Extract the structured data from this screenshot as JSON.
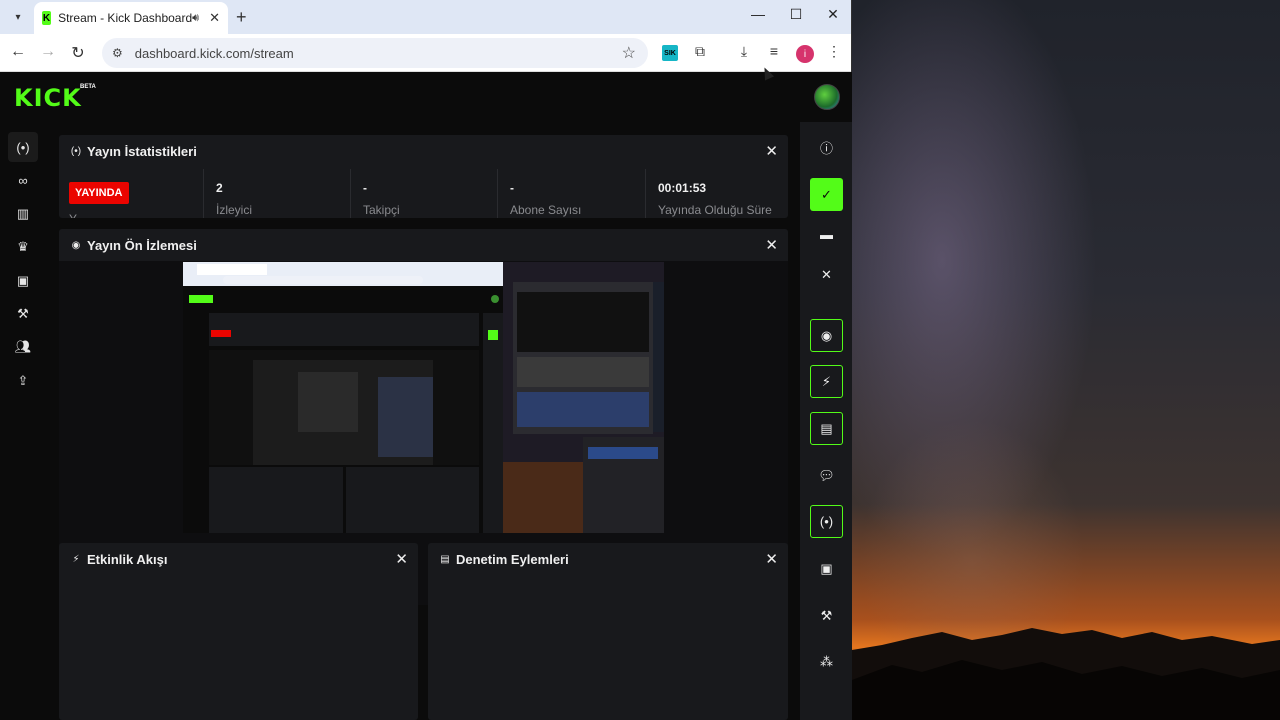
{
  "browser": {
    "tab_title": "Stream - Kick Dashboard",
    "favicon_letter": "K",
    "url": "dashboard.kick.com/stream",
    "extension_label": "SIK",
    "profile_initial": "i"
  },
  "app": {
    "logo": "KICK",
    "logo_badge": "BETA"
  },
  "stats_panel": {
    "title": "Yayın İstatistikleri",
    "live_badge": "YAYINDA",
    "live_sublabel": "Y",
    "stats": [
      {
        "value": "2",
        "label": "İzleyici"
      },
      {
        "value": "-",
        "label": "Takipçi"
      },
      {
        "value": "-",
        "label": "Abone Sayısı"
      },
      {
        "value": "00:01:53",
        "label": "Yayında Olduğu Süre"
      }
    ]
  },
  "preview_panel": {
    "title": "Yayın Ön İzlemesi"
  },
  "events_panel": {
    "title": "Etkinlik Akışı"
  },
  "moderation_panel": {
    "title": "Denetim Eylemleri"
  },
  "left_nav": {
    "icons": [
      "broadcast-icon",
      "link-icon",
      "chart-icon",
      "trophy-icon",
      "video-icon",
      "wrench-icon",
      "users-icon",
      "upload-icon"
    ]
  },
  "right_nav": {
    "icons": [
      "info-icon",
      "check-icon",
      "layout-icon",
      "close-icon",
      "preview-icon",
      "lightning-icon",
      "document-icon",
      "chat-icon",
      "broadcast-icon",
      "camera-icon",
      "wrench-icon",
      "apps-icon"
    ]
  },
  "colors": {
    "accent": "#53fc18",
    "live": "#eb0400",
    "panel": "#18191c",
    "background": "#0b0b0b"
  }
}
